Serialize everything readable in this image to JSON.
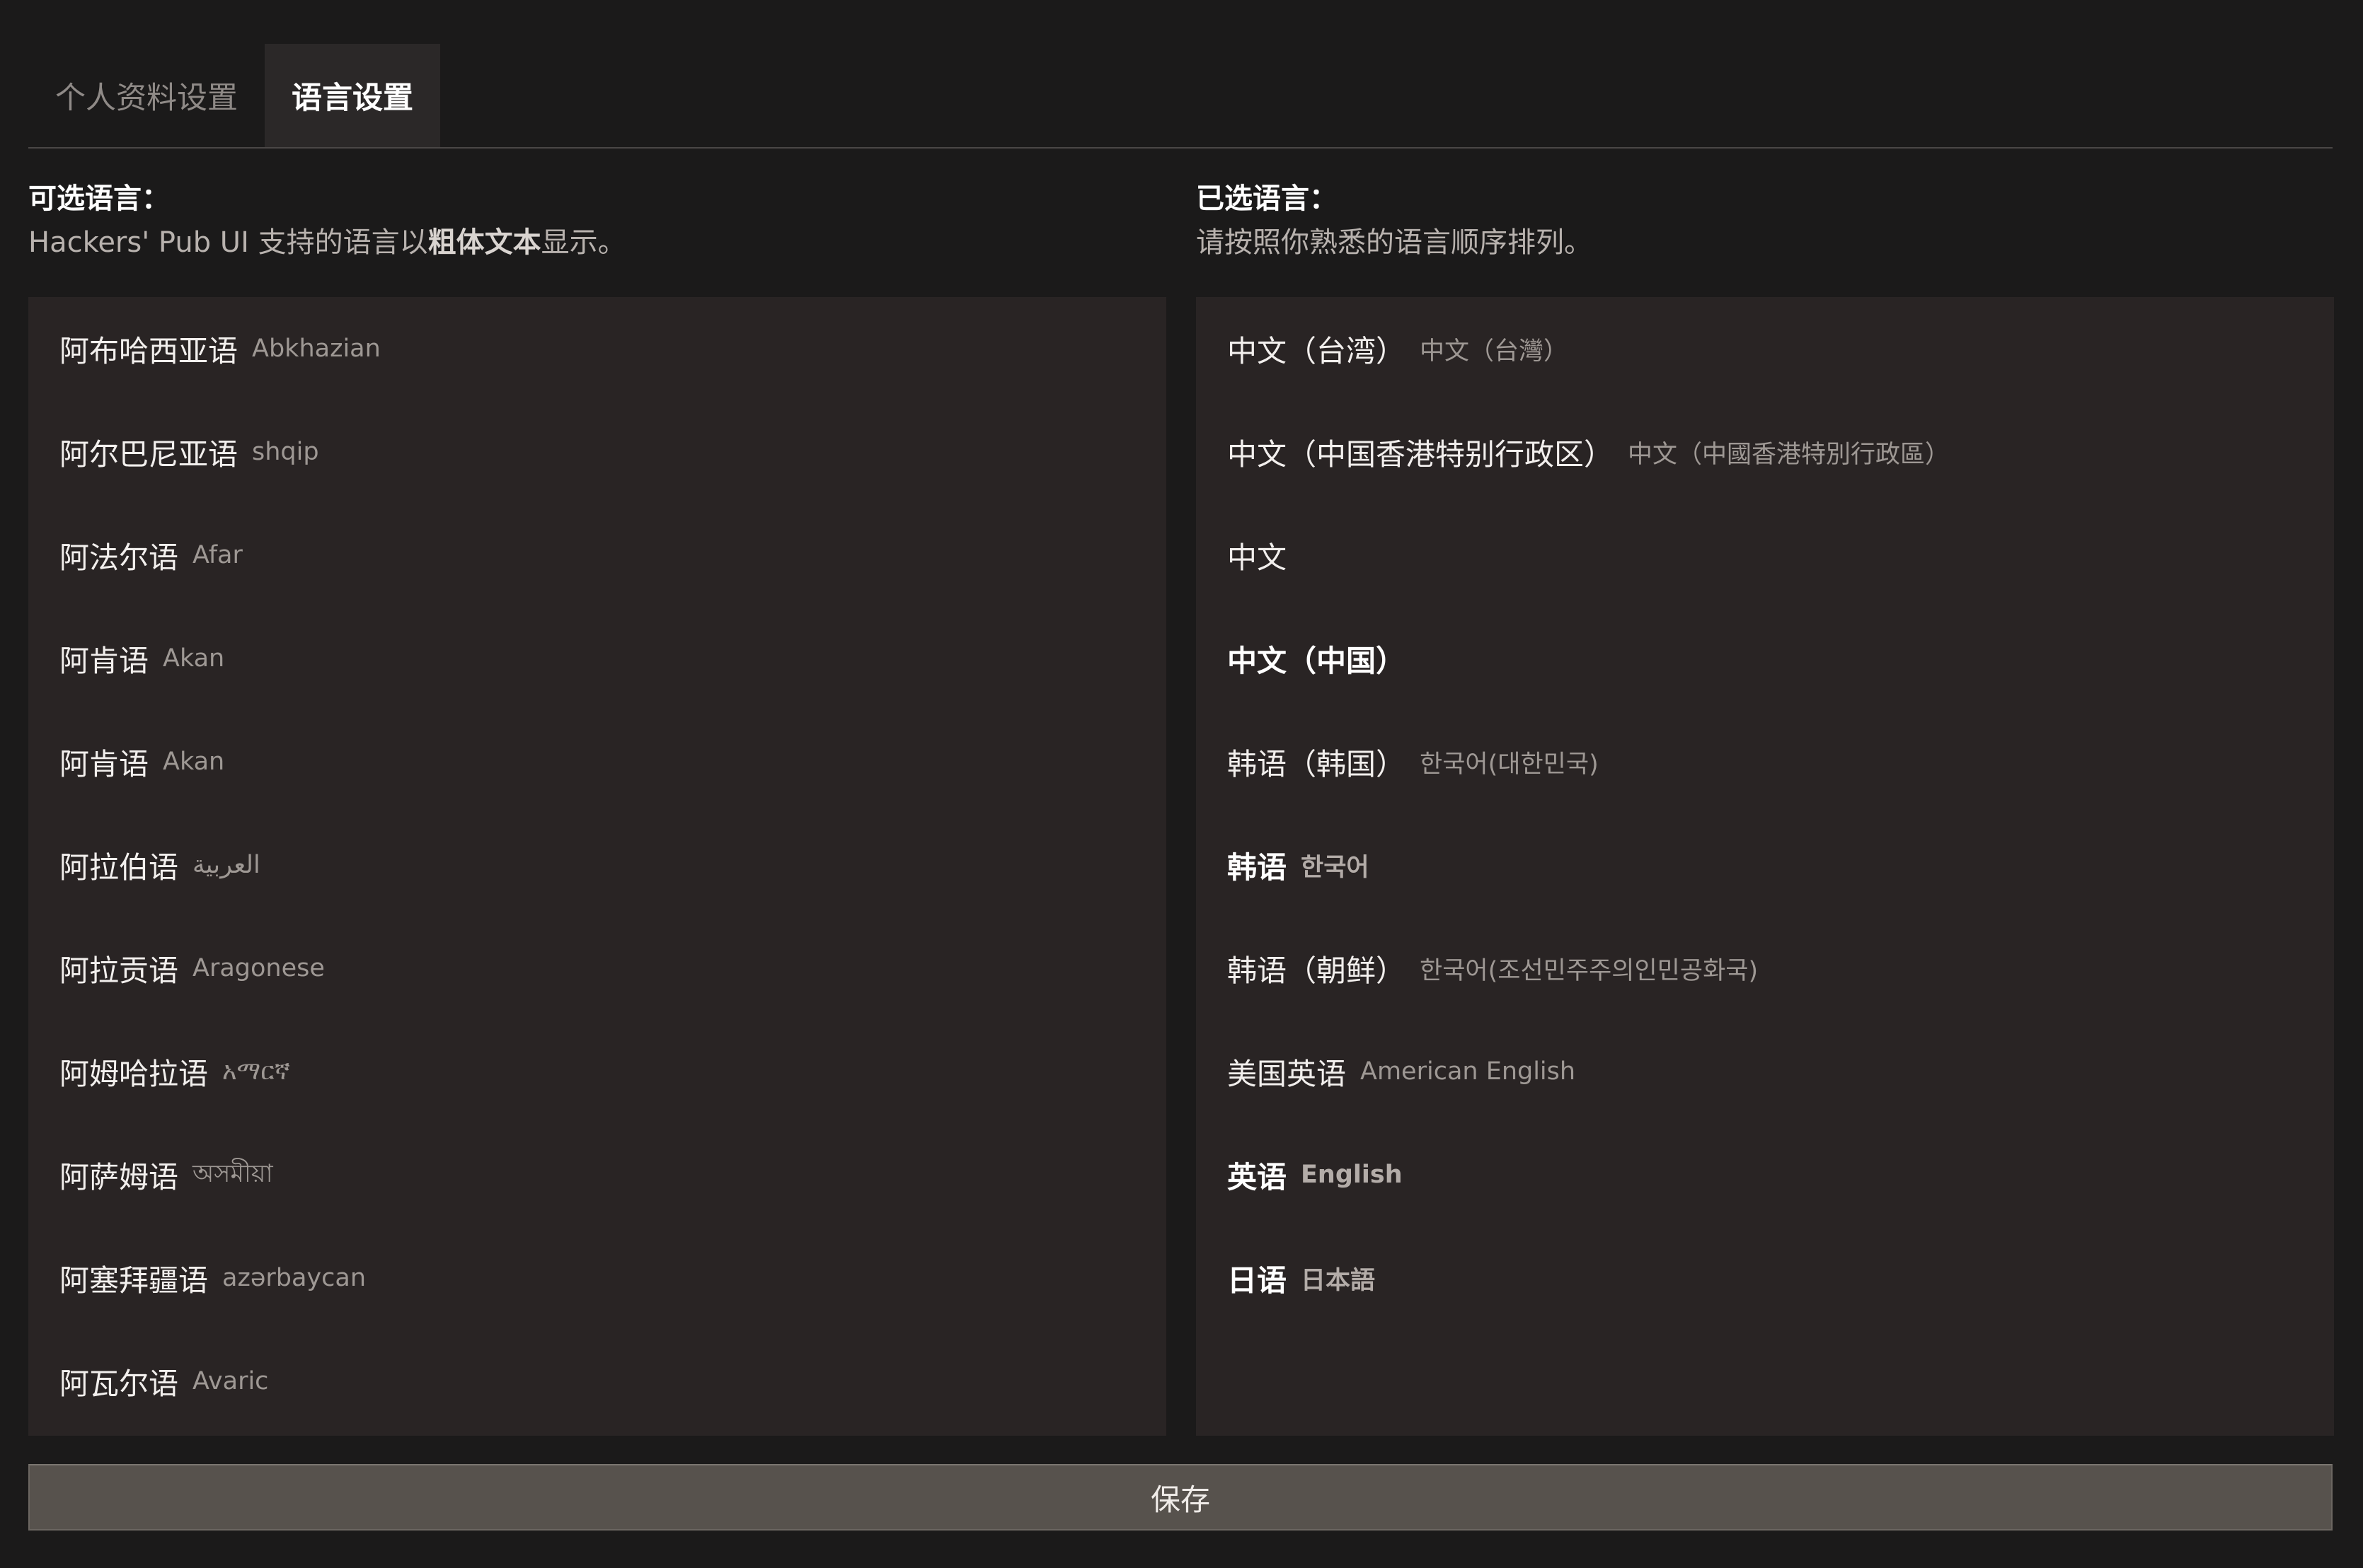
{
  "tabs": {
    "profile": "个人资料设置",
    "language": "语言设置"
  },
  "available": {
    "title": "可选语言：",
    "desc_before": "Hackers' Pub UI 支持的语言以",
    "desc_bold": "粗体文本",
    "desc_after": "显示。",
    "items": [
      {
        "name": "阿布哈西亚语",
        "native": "Abkhazian"
      },
      {
        "name": "阿尔巴尼亚语",
        "native": "shqip"
      },
      {
        "name": "阿法尔语",
        "native": "Afar"
      },
      {
        "name": "阿肯语",
        "native": "Akan"
      },
      {
        "name": "阿肯语",
        "native": "Akan"
      },
      {
        "name": "阿拉伯语",
        "native": "العربية"
      },
      {
        "name": "阿拉贡语",
        "native": "Aragonese"
      },
      {
        "name": "阿姆哈拉语",
        "native": "አማርኛ"
      },
      {
        "name": "阿萨姆语",
        "native": "অসমীয়া"
      },
      {
        "name": "阿塞拜疆语",
        "native": "azərbaycan"
      },
      {
        "name": "阿瓦尔语",
        "native": "Avaric"
      }
    ]
  },
  "selected": {
    "title": "已选语言：",
    "desc": "请按照你熟悉的语言顺序排列。",
    "items": [
      {
        "name": "中文（台湾）",
        "native": "中文（台灣）",
        "supported": false
      },
      {
        "name": "中文（中国香港特别行政区）",
        "native": "中文（中國香港特別行政區）",
        "supported": false
      },
      {
        "name": "中文",
        "native": "",
        "supported": false
      },
      {
        "name": "中文（中国）",
        "native": "",
        "supported": true
      },
      {
        "name": "韩语（韩国）",
        "native": "한국어(대한민국)",
        "supported": false
      },
      {
        "name": "韩语",
        "native": "한국어",
        "supported": true
      },
      {
        "name": "韩语（朝鲜）",
        "native": "한국어(조선민주주의인민공화국)",
        "supported": false
      },
      {
        "name": "美国英语",
        "native": "American English",
        "supported": false
      },
      {
        "name": "英语",
        "native": "English",
        "supported": true
      },
      {
        "name": "日语",
        "native": "日本語",
        "supported": true
      }
    ]
  },
  "save_label": "保存"
}
